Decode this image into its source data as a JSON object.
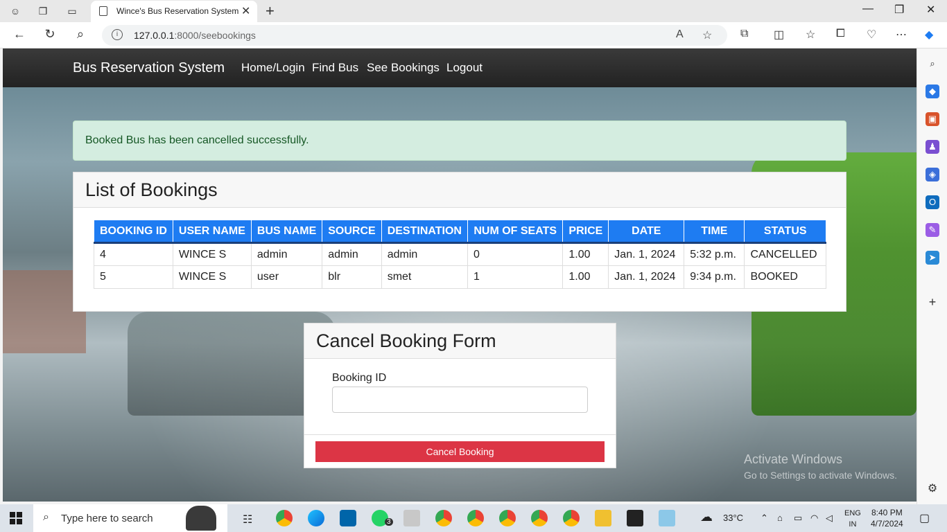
{
  "browser": {
    "tab_title": "Wince's Bus Reservation System",
    "url_host": "127.0.0.1",
    "url_rest": ":8000/seebookings"
  },
  "navbar": {
    "brand": "Bus Reservation System",
    "links": [
      "Home/Login",
      "Find Bus",
      "See Bookings",
      "Logout"
    ]
  },
  "alert": {
    "message": "Booked Bus has been cancelled successfully."
  },
  "bookings": {
    "title": "List of Bookings",
    "columns": [
      "BOOKING ID",
      "USER NAME",
      "BUS NAME",
      "SOURCE",
      "DESTINATION",
      "NUM OF SEATS",
      "PRICE",
      "DATE",
      "TIME",
      "STATUS"
    ],
    "rows": [
      [
        "4",
        "WINCE S",
        "admin",
        "admin",
        "admin",
        "0",
        "1.00",
        "Jan. 1, 2024",
        "5:32 p.m.",
        "CANCELLED"
      ],
      [
        "5",
        "WINCE S",
        "user",
        "blr",
        "smet",
        "1",
        "1.00",
        "Jan. 1, 2024",
        "9:34 p.m.",
        "BOOKED"
      ]
    ]
  },
  "cancel_form": {
    "title": "Cancel Booking Form",
    "label": "Booking ID",
    "value": "",
    "button": "Cancel Booking"
  },
  "watermark": {
    "line1": "Activate Windows",
    "line2": "Go to Settings to activate Windows."
  },
  "taskbar": {
    "search_placeholder": "Type here to search",
    "badge": "3",
    "weather": "33°C",
    "lang1": "ENG",
    "lang2": "IN",
    "time": "8:40 PM",
    "date": "4/7/2024"
  },
  "colors": {
    "accent": "#1e7cf2",
    "danger": "#dc3545",
    "success_bg": "#d4ede0"
  }
}
